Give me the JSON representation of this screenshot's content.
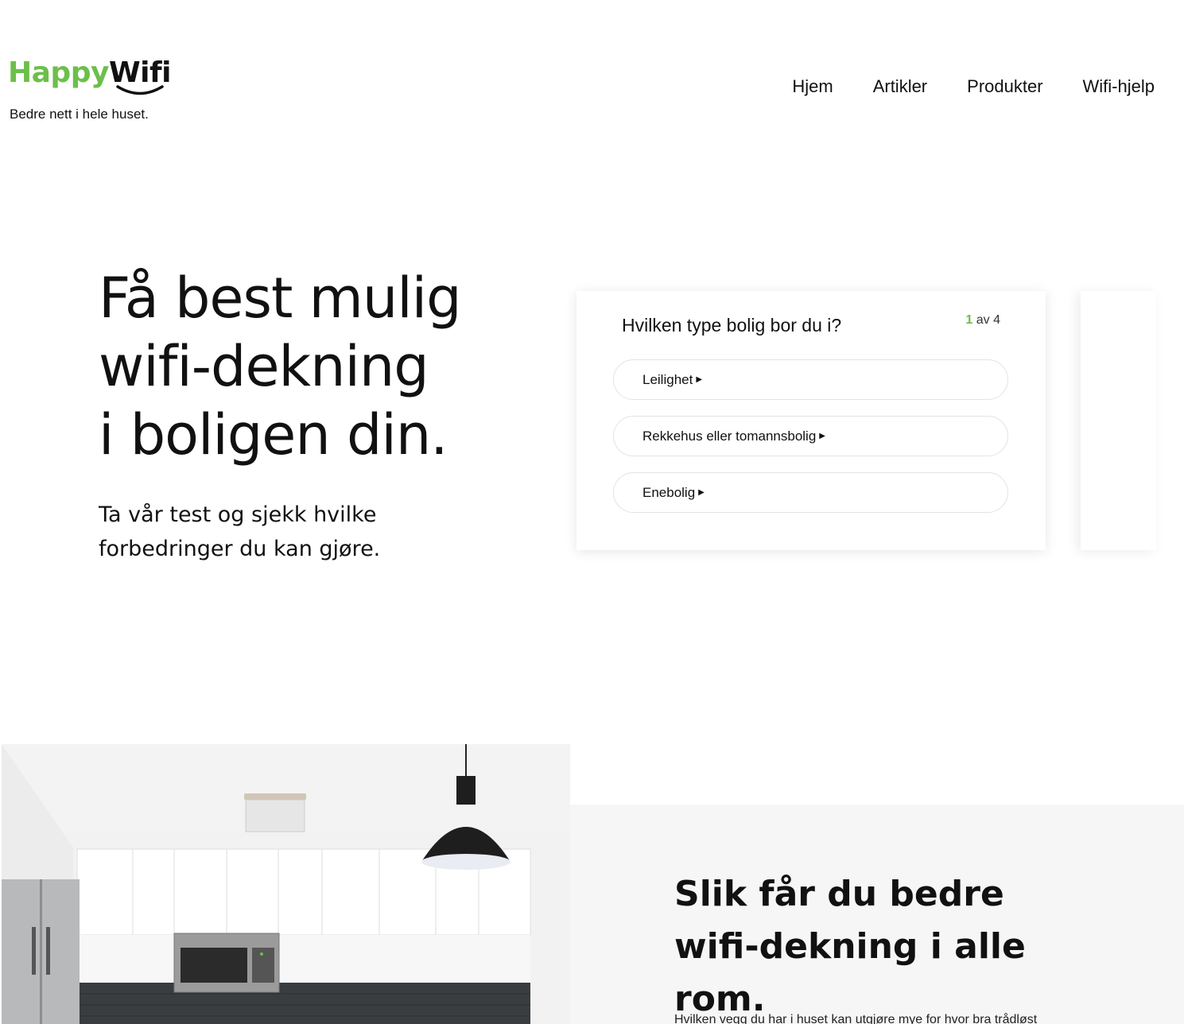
{
  "brand": {
    "name_part1": "Happy",
    "name_part2": "Wifi",
    "tagline": "Bedre nett i hele huset.",
    "colors": {
      "green": "#6cbf4a",
      "dark": "#111111"
    }
  },
  "nav": {
    "items": [
      {
        "label": "Hjem"
      },
      {
        "label": "Artikler"
      },
      {
        "label": "Produkter"
      },
      {
        "label": "Wifi-hjelp"
      }
    ]
  },
  "hero": {
    "title_line1": "Få best mulig",
    "title_line2": "wifi-dekning",
    "title_line3": "i boligen din.",
    "subtitle_line1": "Ta vår test og sjekk hvilke",
    "subtitle_line2": "forbedringer du kan gjøre."
  },
  "quiz": {
    "question": "Hvilken type bolig bor du i?",
    "step_current": "1",
    "step_total_text": " av 4",
    "options": [
      {
        "label": "Leilighet"
      },
      {
        "label": "Rekkehus eller tomannsbolig"
      },
      {
        "label": "Enebolig"
      }
    ]
  },
  "info": {
    "title": "Slik får du bedre wifi-dekning i alle rom.",
    "text": "Hvilken vegg du har i huset kan utgjøre mye for hvor bra trådløst"
  }
}
